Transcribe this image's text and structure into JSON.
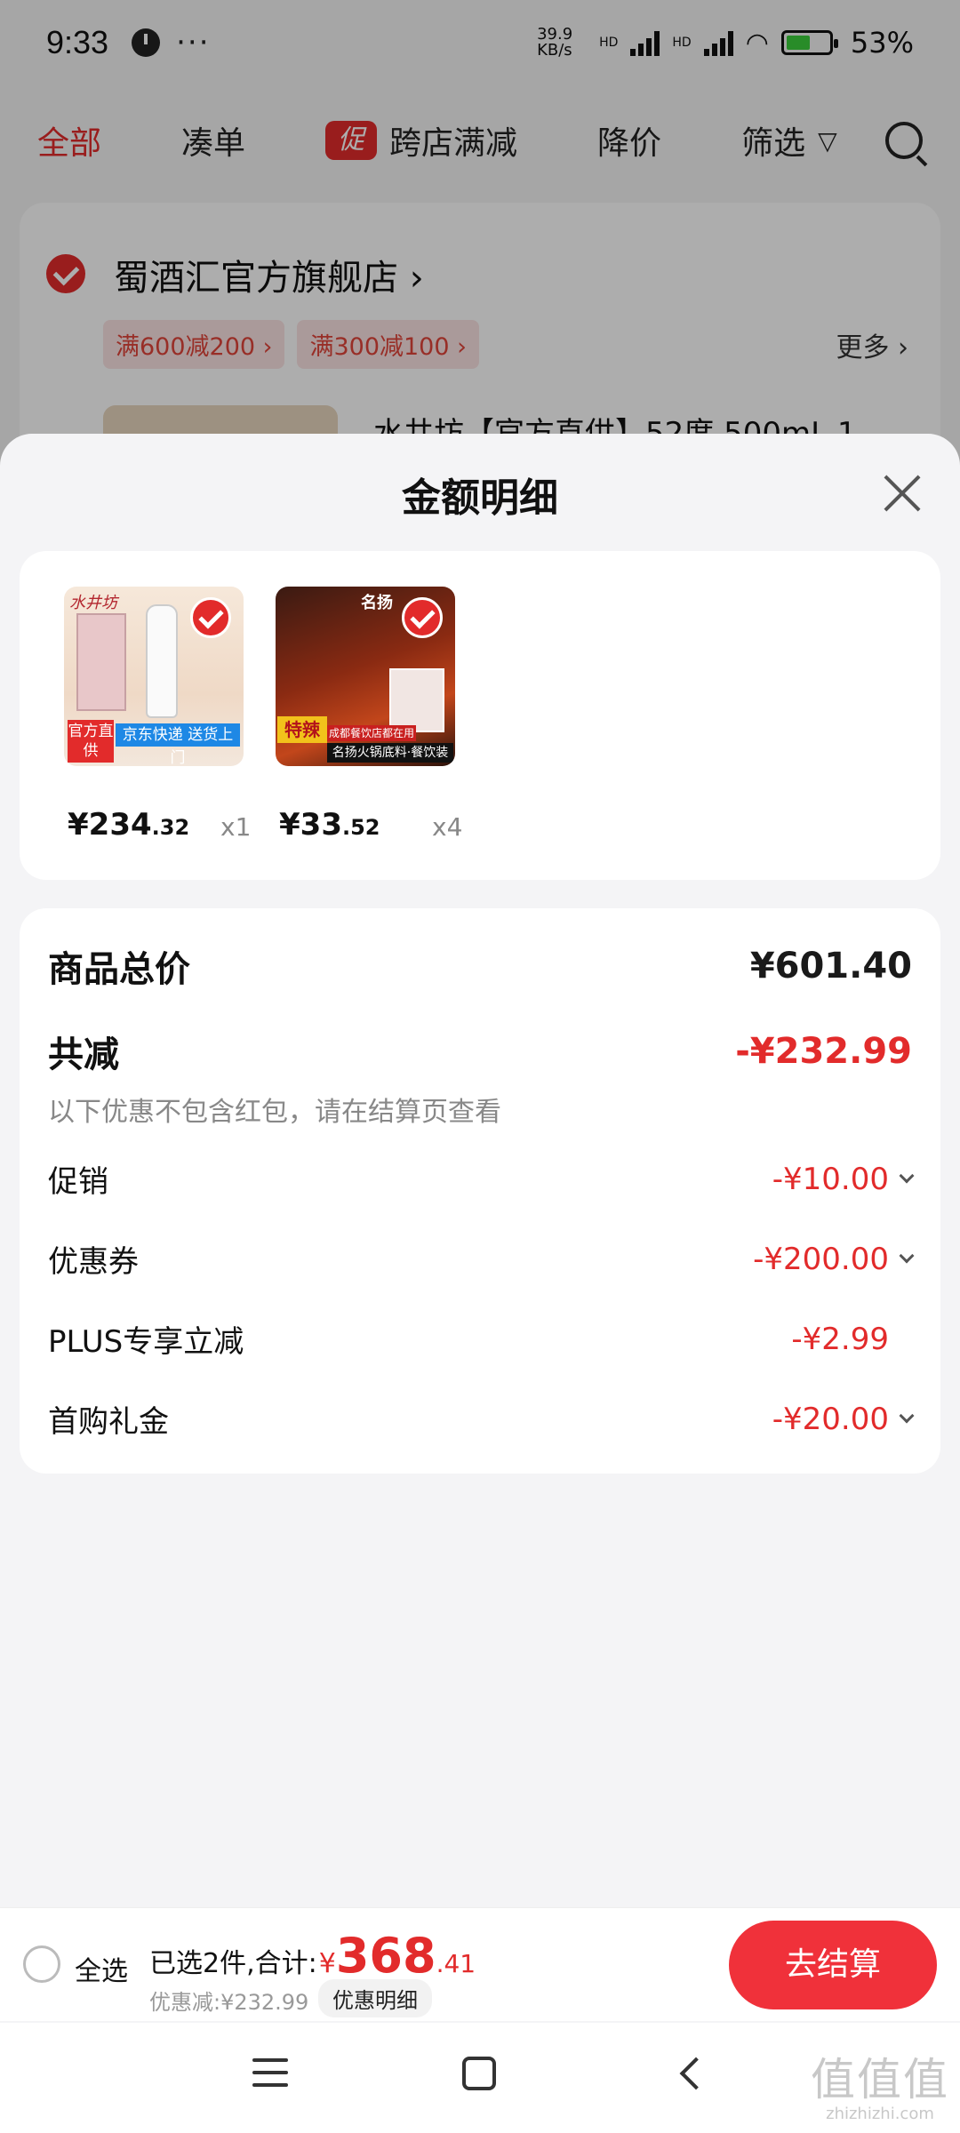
{
  "status_bar": {
    "time": "9:33",
    "dots": "···",
    "net_speed": "39.9 KB/s",
    "hd1": "HD",
    "hd2": "HD",
    "battery": "53%"
  },
  "filter_bar": {
    "all": "全部",
    "bundle": "凑单",
    "promo_badge": "促",
    "cross_store": "跨店满减",
    "price_drop": "降价",
    "filter": "筛选"
  },
  "store": {
    "name": "蜀酒汇官方旗舰店",
    "coupons": [
      "满600减200",
      "满300减100"
    ],
    "more": "更多",
    "product_title": "水井坊【官方直供】52度 500mL 1"
  },
  "sheet": {
    "title": "金额明细",
    "goods": [
      {
        "price_int": "¥234",
        "price_dec": ".32",
        "qty": "x1",
        "label_a": "官方直供",
        "label_b": "京东快递 送货上门",
        "logo": "水井坊"
      },
      {
        "price_int": "¥33",
        "price_dec": ".52",
        "qty": "x4",
        "brand": "名扬",
        "tag": "特辣",
        "strip": "名扬火锅底料·餐饮装",
        "strip2": "成都餐饮店都在用"
      }
    ],
    "total_label": "商品总价",
    "total_value": "¥601.40",
    "reduce_label": "共减",
    "reduce_value": "-¥232.99",
    "note": "以下优惠不包含红包，请在结算页查看",
    "items": [
      {
        "label": "促销",
        "value": "-¥10.00"
      },
      {
        "label": "优惠券",
        "value": "-¥200.00"
      },
      {
        "label": "PLUS专享立减",
        "value": "-¥2.99"
      },
      {
        "label": "首购礼金",
        "value": "-¥20.00"
      }
    ]
  },
  "checkout": {
    "select_all": "全选",
    "summary_label": "已选2件,合计:",
    "currency": "¥",
    "total_int": "368",
    "total_dec": ".41",
    "saved": "优惠减:¥232.99",
    "detail_chip": "优惠明细",
    "pay_button": "去结算"
  },
  "watermark": {
    "big": "值值值",
    "small": "zhizhizhi.com"
  },
  "colors": {
    "accent": "#e22b2b",
    "pay_button": "#f0313a",
    "sheet_bg": "#f4f4f6"
  }
}
